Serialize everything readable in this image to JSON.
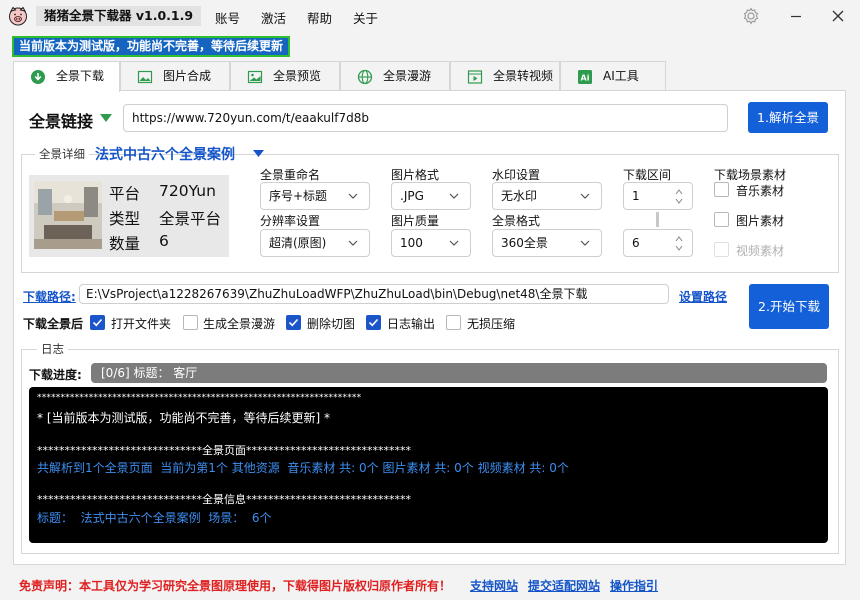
{
  "app": {
    "title": "猪猪全景下载器  v1.0.1.9",
    "menu": [
      "账号",
      "激活",
      "帮助",
      "关于"
    ]
  },
  "notice": "当前版本为测试版，功能尚不完善，等待后续更新",
  "tabs": [
    "全景下载",
    "图片合成",
    "全景预览",
    "全景漫游",
    "全景转视频",
    "AI工具"
  ],
  "link_section": {
    "label": "全景链接",
    "url": "https://www.720yun.com/t/eaakulf7d8b",
    "parse_button": "1.解析全景"
  },
  "details": {
    "group_label": "全景详细",
    "case_title": "法式中古六个全景案例",
    "info": [
      {
        "key": "平台",
        "value": "720Yun"
      },
      {
        "key": "类型",
        "value": "全景平台"
      },
      {
        "key": "数量",
        "value": "6"
      }
    ],
    "rename_label": "全景重命名",
    "rename_value": "序号+标题",
    "format_label": "图片格式",
    "format_value": ".JPG",
    "watermark_label": "水印设置",
    "watermark_value": "无水印",
    "range_label": "下载区间",
    "range_start": "1",
    "range_end": "6",
    "scene_material_label": "下载场景素材",
    "music_label": "音乐素材",
    "image_label": "图片素材",
    "video_label": "视频素材",
    "resolution_label": "分辨率设置",
    "resolution_value": "超清(原图)",
    "quality_label": "图片质量",
    "quality_value": "100",
    "pano_format_label": "全景格式",
    "pano_format_value": "360全景"
  },
  "download": {
    "path_label": "下载路径:",
    "path_value": "E:\\VsProject\\a1228267639\\ZhuZhuLoadWFP\\ZhuZhuLoad\\bin\\Debug\\net48\\全景下载",
    "set_path_link": "设置路径",
    "start_button": "2.开始下载",
    "after_label": "下载全景后",
    "options": [
      {
        "label": "打开文件夹",
        "checked": true
      },
      {
        "label": "生成全景漫游",
        "checked": false
      },
      {
        "label": "删除切图",
        "checked": true
      },
      {
        "label": "日志输出",
        "checked": true
      },
      {
        "label": "无损压缩",
        "checked": false
      }
    ]
  },
  "log": {
    "group_label": "日志",
    "progress_label": "下载进度:",
    "progress_text": "[0/6] 标题： 客厅",
    "progress_fraction": 0,
    "lines": [
      "*********************************************************************",
      "* [当前版本为测试版，功能尚不完善，等待后续更新] *",
      "******************************全景页面******************************",
      "共解析到1个全景页面  当前为第1个 其他资源  音乐素材 共: 0个 图片素材 共: 0个 视频素材 共: 0个",
      "******************************全景信息******************************",
      "标题：  法式中古六个全景案例  场景：  6个"
    ]
  },
  "footer": {
    "disclaimer": "免责声明：本工具仅为学习研究全景图原理使用，下载得图片版权归原作者所有！",
    "links": [
      "支持网站",
      "提交适配网站",
      "操作指引"
    ]
  },
  "colors": {
    "accent": "#1460d8",
    "notice_bg": "#1565c0",
    "notice_border": "#2dbf2d",
    "console_text": "#ffffff",
    "console_highlight": "#3d8ef0",
    "disclaimer": "#e02020"
  }
}
